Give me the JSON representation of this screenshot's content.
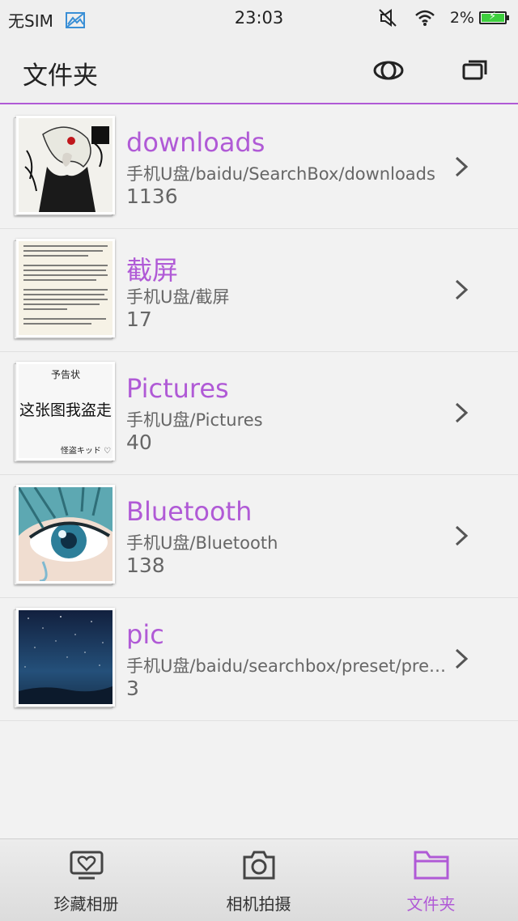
{
  "status_bar": {
    "sim": "无SIM",
    "time": "23:03",
    "battery_pct": "2%"
  },
  "header": {
    "title": "文件夹"
  },
  "folders": [
    {
      "name": "downloads",
      "path": "手机U盘/baidu/SearchBox/downloads",
      "count": "1136",
      "thumb": "anime-dark"
    },
    {
      "name": "截屏",
      "path": "手机U盘/截屏",
      "count": "17",
      "thumb": "text-doc"
    },
    {
      "name": "Pictures",
      "path": "手机U盘/Pictures",
      "count": "40",
      "thumb": "notice",
      "thumb_text": {
        "title": "予告状",
        "main": "这张图我盗走",
        "sign": "怪盗キッド ♡"
      }
    },
    {
      "name": "Bluetooth",
      "path": "手机U盘/Bluetooth",
      "count": "138",
      "thumb": "anime-eye"
    },
    {
      "name": "pic",
      "path": "手机U盘/baidu/searchbox/preset/pre…",
      "count": "3",
      "thumb": "night-sky"
    }
  ],
  "bottom_nav": {
    "items": [
      {
        "label": "珍藏相册",
        "icon": "heart-album-icon",
        "active": false
      },
      {
        "label": "相机拍摄",
        "icon": "camera-icon",
        "active": false
      },
      {
        "label": "文件夹",
        "icon": "folder-icon",
        "active": true
      }
    ]
  },
  "colors": {
    "accent": "#b05ad6",
    "background": "#f2f2f2"
  }
}
